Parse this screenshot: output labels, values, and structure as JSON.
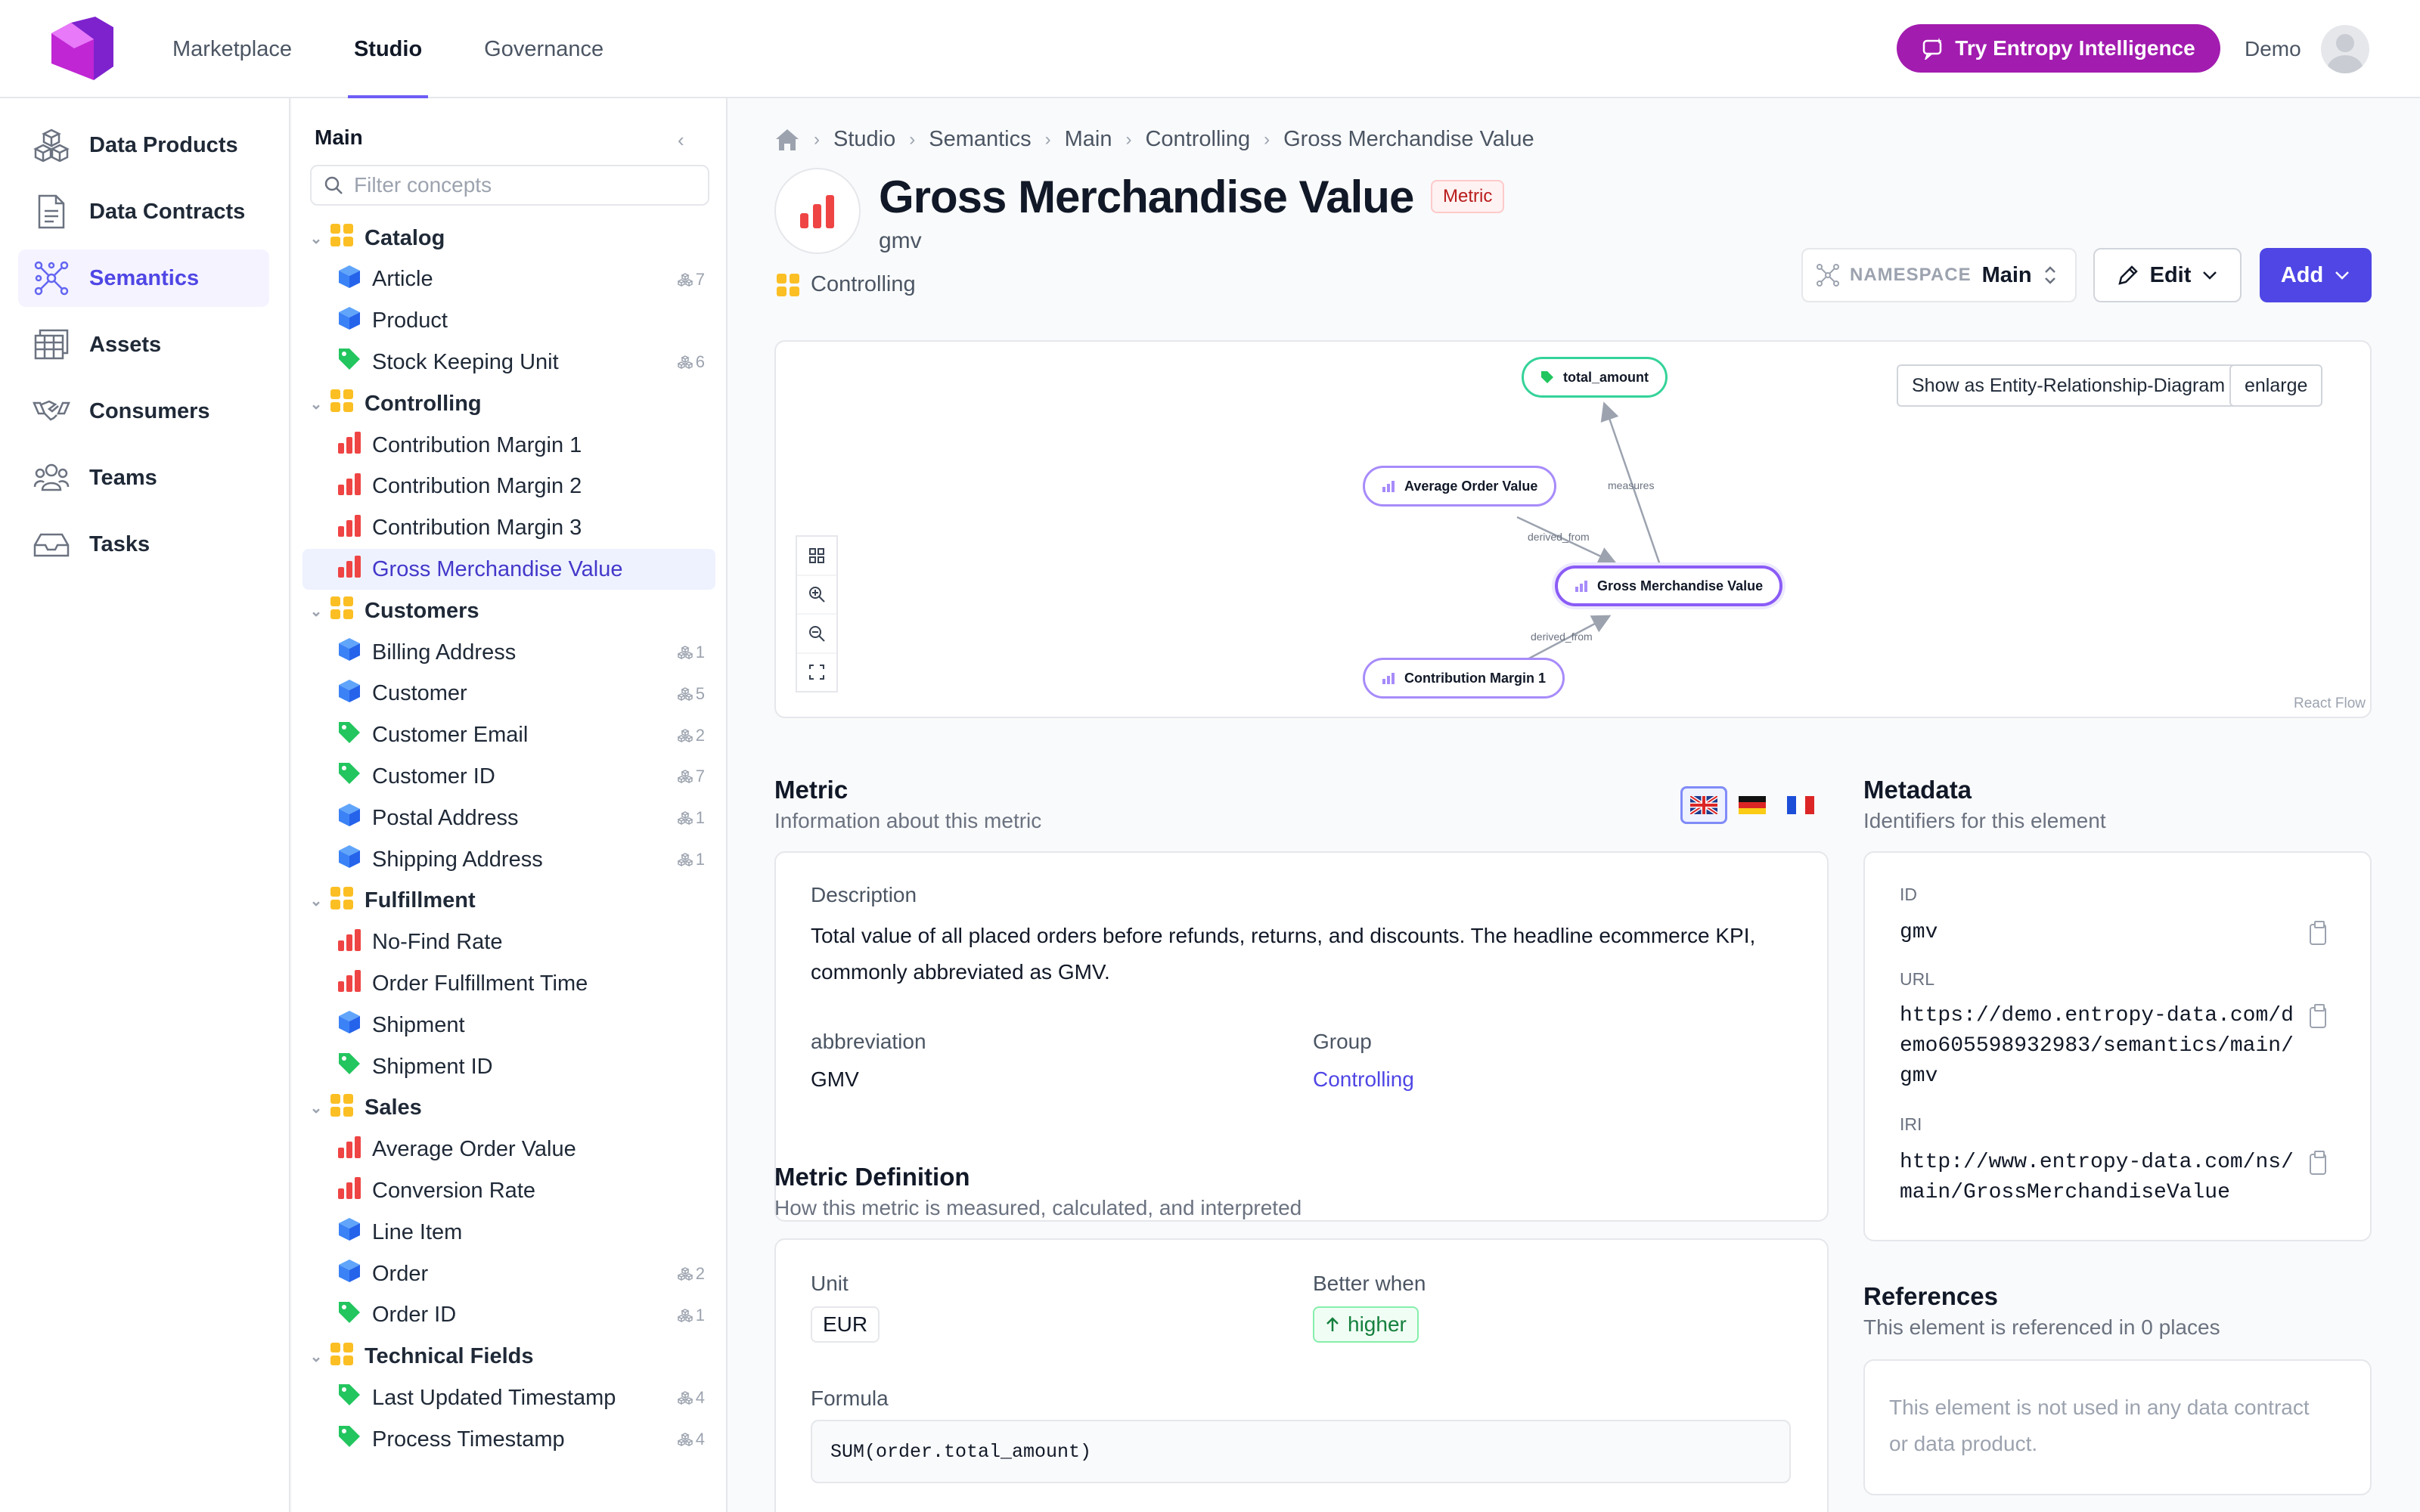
{
  "topnav": {
    "tabs": [
      "Marketplace",
      "Studio",
      "Governance"
    ],
    "active": "Studio",
    "cta": "Try Entropy Intelligence",
    "user": "Demo"
  },
  "sidebar": {
    "items": [
      {
        "label": "Data Products",
        "icon": "cube-stack-icon"
      },
      {
        "label": "Data Contracts",
        "icon": "document-icon"
      },
      {
        "label": "Semantics",
        "icon": "network-icon",
        "active": true
      },
      {
        "label": "Assets",
        "icon": "table-icon"
      },
      {
        "label": "Consumers",
        "icon": "handshake-icon"
      },
      {
        "label": "Teams",
        "icon": "users-icon"
      },
      {
        "label": "Tasks",
        "icon": "inbox-icon"
      }
    ]
  },
  "tree": {
    "title": "Main",
    "filter_placeholder": "Filter concepts",
    "groups": [
      {
        "label": "Catalog",
        "items": [
          {
            "label": "Article",
            "type": "entity",
            "count": "7"
          },
          {
            "label": "Product",
            "type": "entity",
            "count": ""
          },
          {
            "label": "Stock Keeping Unit",
            "type": "property",
            "count": "6"
          }
        ]
      },
      {
        "label": "Controlling",
        "items": [
          {
            "label": "Contribution Margin 1",
            "type": "metric",
            "count": ""
          },
          {
            "label": "Contribution Margin 2",
            "type": "metric",
            "count": ""
          },
          {
            "label": "Contribution Margin 3",
            "type": "metric",
            "count": ""
          },
          {
            "label": "Gross Merchandise Value",
            "type": "metric",
            "count": "",
            "selected": true
          }
        ]
      },
      {
        "label": "Customers",
        "items": [
          {
            "label": "Billing Address",
            "type": "entity",
            "count": "1"
          },
          {
            "label": "Customer",
            "type": "entity",
            "count": "5"
          },
          {
            "label": "Customer Email",
            "type": "property",
            "count": "2"
          },
          {
            "label": "Customer ID",
            "type": "property",
            "count": "7"
          },
          {
            "label": "Postal Address",
            "type": "entity",
            "count": "1"
          },
          {
            "label": "Shipping Address",
            "type": "entity",
            "count": "1"
          }
        ]
      },
      {
        "label": "Fulfillment",
        "items": [
          {
            "label": "No-Find Rate",
            "type": "metric",
            "count": ""
          },
          {
            "label": "Order Fulfillment Time",
            "type": "metric",
            "count": ""
          },
          {
            "label": "Shipment",
            "type": "entity",
            "count": ""
          },
          {
            "label": "Shipment ID",
            "type": "property",
            "count": ""
          }
        ]
      },
      {
        "label": "Sales",
        "items": [
          {
            "label": "Average Order Value",
            "type": "metric",
            "count": ""
          },
          {
            "label": "Conversion Rate",
            "type": "metric",
            "count": ""
          },
          {
            "label": "Line Item",
            "type": "entity",
            "count": ""
          },
          {
            "label": "Order",
            "type": "entity",
            "count": "2"
          },
          {
            "label": "Order ID",
            "type": "property",
            "count": "1"
          }
        ]
      },
      {
        "label": "Technical Fields",
        "items": [
          {
            "label": "Last Updated Timestamp",
            "type": "property",
            "count": "4"
          },
          {
            "label": "Process Timestamp",
            "type": "property",
            "count": "4"
          }
        ]
      }
    ]
  },
  "breadcrumb": [
    "Studio",
    "Semantics",
    "Main",
    "Controlling",
    "Gross Merchandise Value"
  ],
  "header": {
    "title": "Gross Merchandise Value",
    "badge": "Metric",
    "subtitle": "gmv",
    "group": "Controlling",
    "namespace_label": "NAMESPACE",
    "namespace_value": "Main",
    "edit_label": "Edit",
    "add_label": "Add"
  },
  "graph": {
    "erd_button": "Show as Entity-Relationship-Diagram",
    "enlarge_button": "enlarge",
    "attribution": "React Flow",
    "nodes": {
      "total_amount": "total_amount",
      "aov": "Average Order Value",
      "gmv": "Gross Merchandise Value",
      "cm1": "Contribution Margin 1"
    },
    "edges": {
      "measures": "measures",
      "derived1": "derived_from",
      "derived2": "derived_from"
    }
  },
  "metric": {
    "heading": "Metric",
    "subheading": "Information about this metric",
    "flags": [
      "gb-flag-icon",
      "de-flag-icon",
      "fr-flag-icon"
    ],
    "description_label": "Description",
    "description": "Total value of all placed orders before refunds, returns, and discounts. The headline ecommerce KPI, commonly abbreviated as GMV.",
    "abbreviation_label": "abbreviation",
    "abbreviation": "GMV",
    "group_label": "Group",
    "group": "Controlling"
  },
  "definition": {
    "heading": "Metric Definition",
    "subheading": "How this metric is measured, calculated, and interpreted",
    "unit_label": "Unit",
    "unit": "EUR",
    "better_label": "Better when",
    "better": "higher",
    "formula_label": "Formula",
    "formula": "SUM(order.total_amount)"
  },
  "metadata": {
    "heading": "Metadata",
    "subheading": "Identifiers for this element",
    "id_label": "ID",
    "id": "gmv",
    "url_label": "URL",
    "url_lines": [
      "https://demo.entropy-data.com/d",
      "emo605598932983/semantics/main/",
      "gmv"
    ],
    "iri_label": "IRI",
    "iri_lines": [
      "http://www.entropy-data.com/ns/",
      "main/GrossMerchandiseValue"
    ]
  },
  "references": {
    "heading": "References",
    "subheading": "This element is referenced in 0 places",
    "empty_lines": [
      "This element is not used in any data contract",
      "or data product."
    ]
  },
  "colors": {
    "accent": "#4f46e5",
    "metric": "#ef4444",
    "entity": "#3b82f6",
    "property": "#22c55e",
    "group": "#fbbf24",
    "cta": "#a21caf"
  }
}
